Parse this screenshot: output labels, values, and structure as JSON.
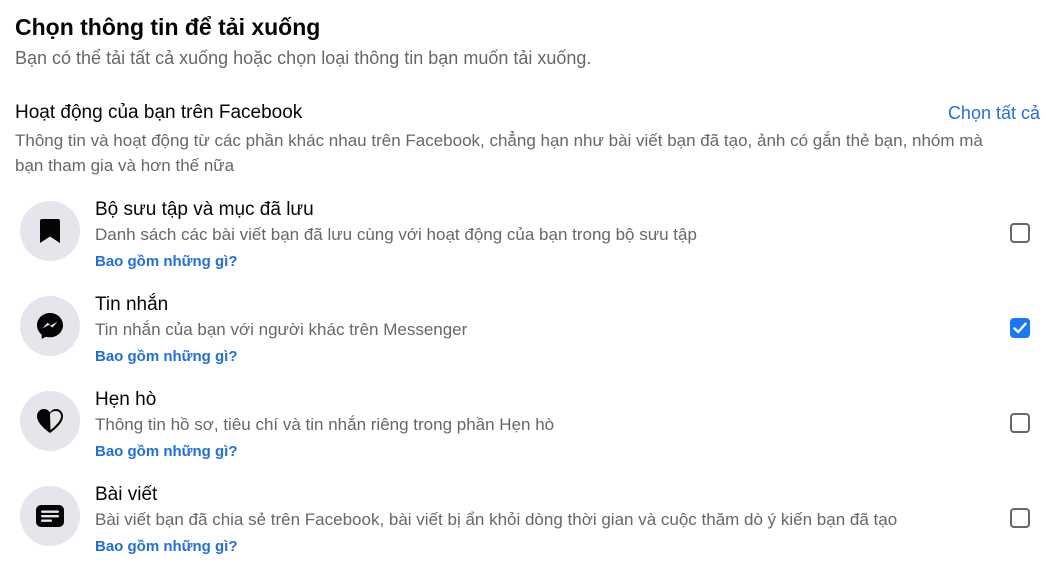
{
  "header": {
    "title": "Chọn thông tin để tải xuống",
    "subtitle": "Bạn có thể tải tất cả xuống hoặc chọn loại thông tin bạn muốn tải xuống."
  },
  "section": {
    "title": "Hoạt động của bạn trên Facebook",
    "select_all": "Chọn tất cả",
    "description": "Thông tin và hoạt động từ các phần khác nhau trên Facebook, chẳng hạn như bài viết bạn đã tạo, ảnh có gắn thẻ bạn, nhóm mà bạn tham gia và hơn thế nữa"
  },
  "items": [
    {
      "icon": "bookmark-icon",
      "title": "Bộ sưu tập và mục đã lưu",
      "description": "Danh sách các bài viết bạn đã lưu cùng với hoạt động của bạn trong bộ sưu tập",
      "link": "Bao gồm những gì?",
      "checked": false
    },
    {
      "icon": "messenger-icon",
      "title": "Tin nhắn",
      "description": "Tin nhắn của bạn với người khác trên Messenger",
      "link": "Bao gồm những gì?",
      "checked": true
    },
    {
      "icon": "heart-icon",
      "title": "Hẹn hò",
      "description": "Thông tin hồ sơ, tiêu chí và tin nhắn riêng trong phần Hẹn hò",
      "link": "Bao gồm những gì?",
      "checked": false
    },
    {
      "icon": "post-icon",
      "title": "Bài viết",
      "description": "Bài viết bạn đã chia sẻ trên Facebook, bài viết bị ẩn khỏi dòng thời gian và cuộc thăm dò ý kiến bạn đã tạo",
      "link": "Bao gồm những gì?",
      "checked": false
    }
  ],
  "colors": {
    "accent": "#1877f2",
    "link": "#216fdb",
    "icon_bg": "#e4e6eb",
    "muted_text": "#65676b"
  }
}
